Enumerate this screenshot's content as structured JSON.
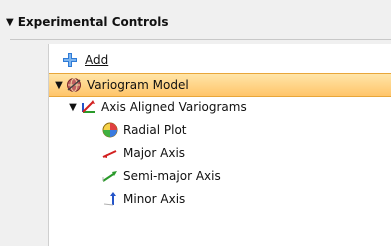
{
  "panel": {
    "title": "Experimental Controls"
  },
  "add": {
    "label": "Add"
  },
  "tree": {
    "variogram_model": "Variogram Model",
    "axis_aligned": "Axis Aligned Variograms",
    "radial_plot": "Radial Plot",
    "major_axis": "Major Axis",
    "semi_major_axis": "Semi-major Axis",
    "minor_axis": "Minor Axis"
  },
  "icons": {
    "expander": "triangle-down",
    "add": "plus-icon",
    "variogram_model": "globe-icon",
    "axis_aligned": "axes-icon",
    "radial_plot": "radial-plot-icon",
    "major_axis": "red-arrow-icon",
    "semi_major_axis": "green-arrow-icon",
    "minor_axis": "blue-arrow-icon"
  },
  "colors": {
    "selection": "#ffc56a",
    "major": "#d22020",
    "semi_major": "#2a9a2a",
    "minor": "#2454c8",
    "add": "#2f7bd6"
  }
}
